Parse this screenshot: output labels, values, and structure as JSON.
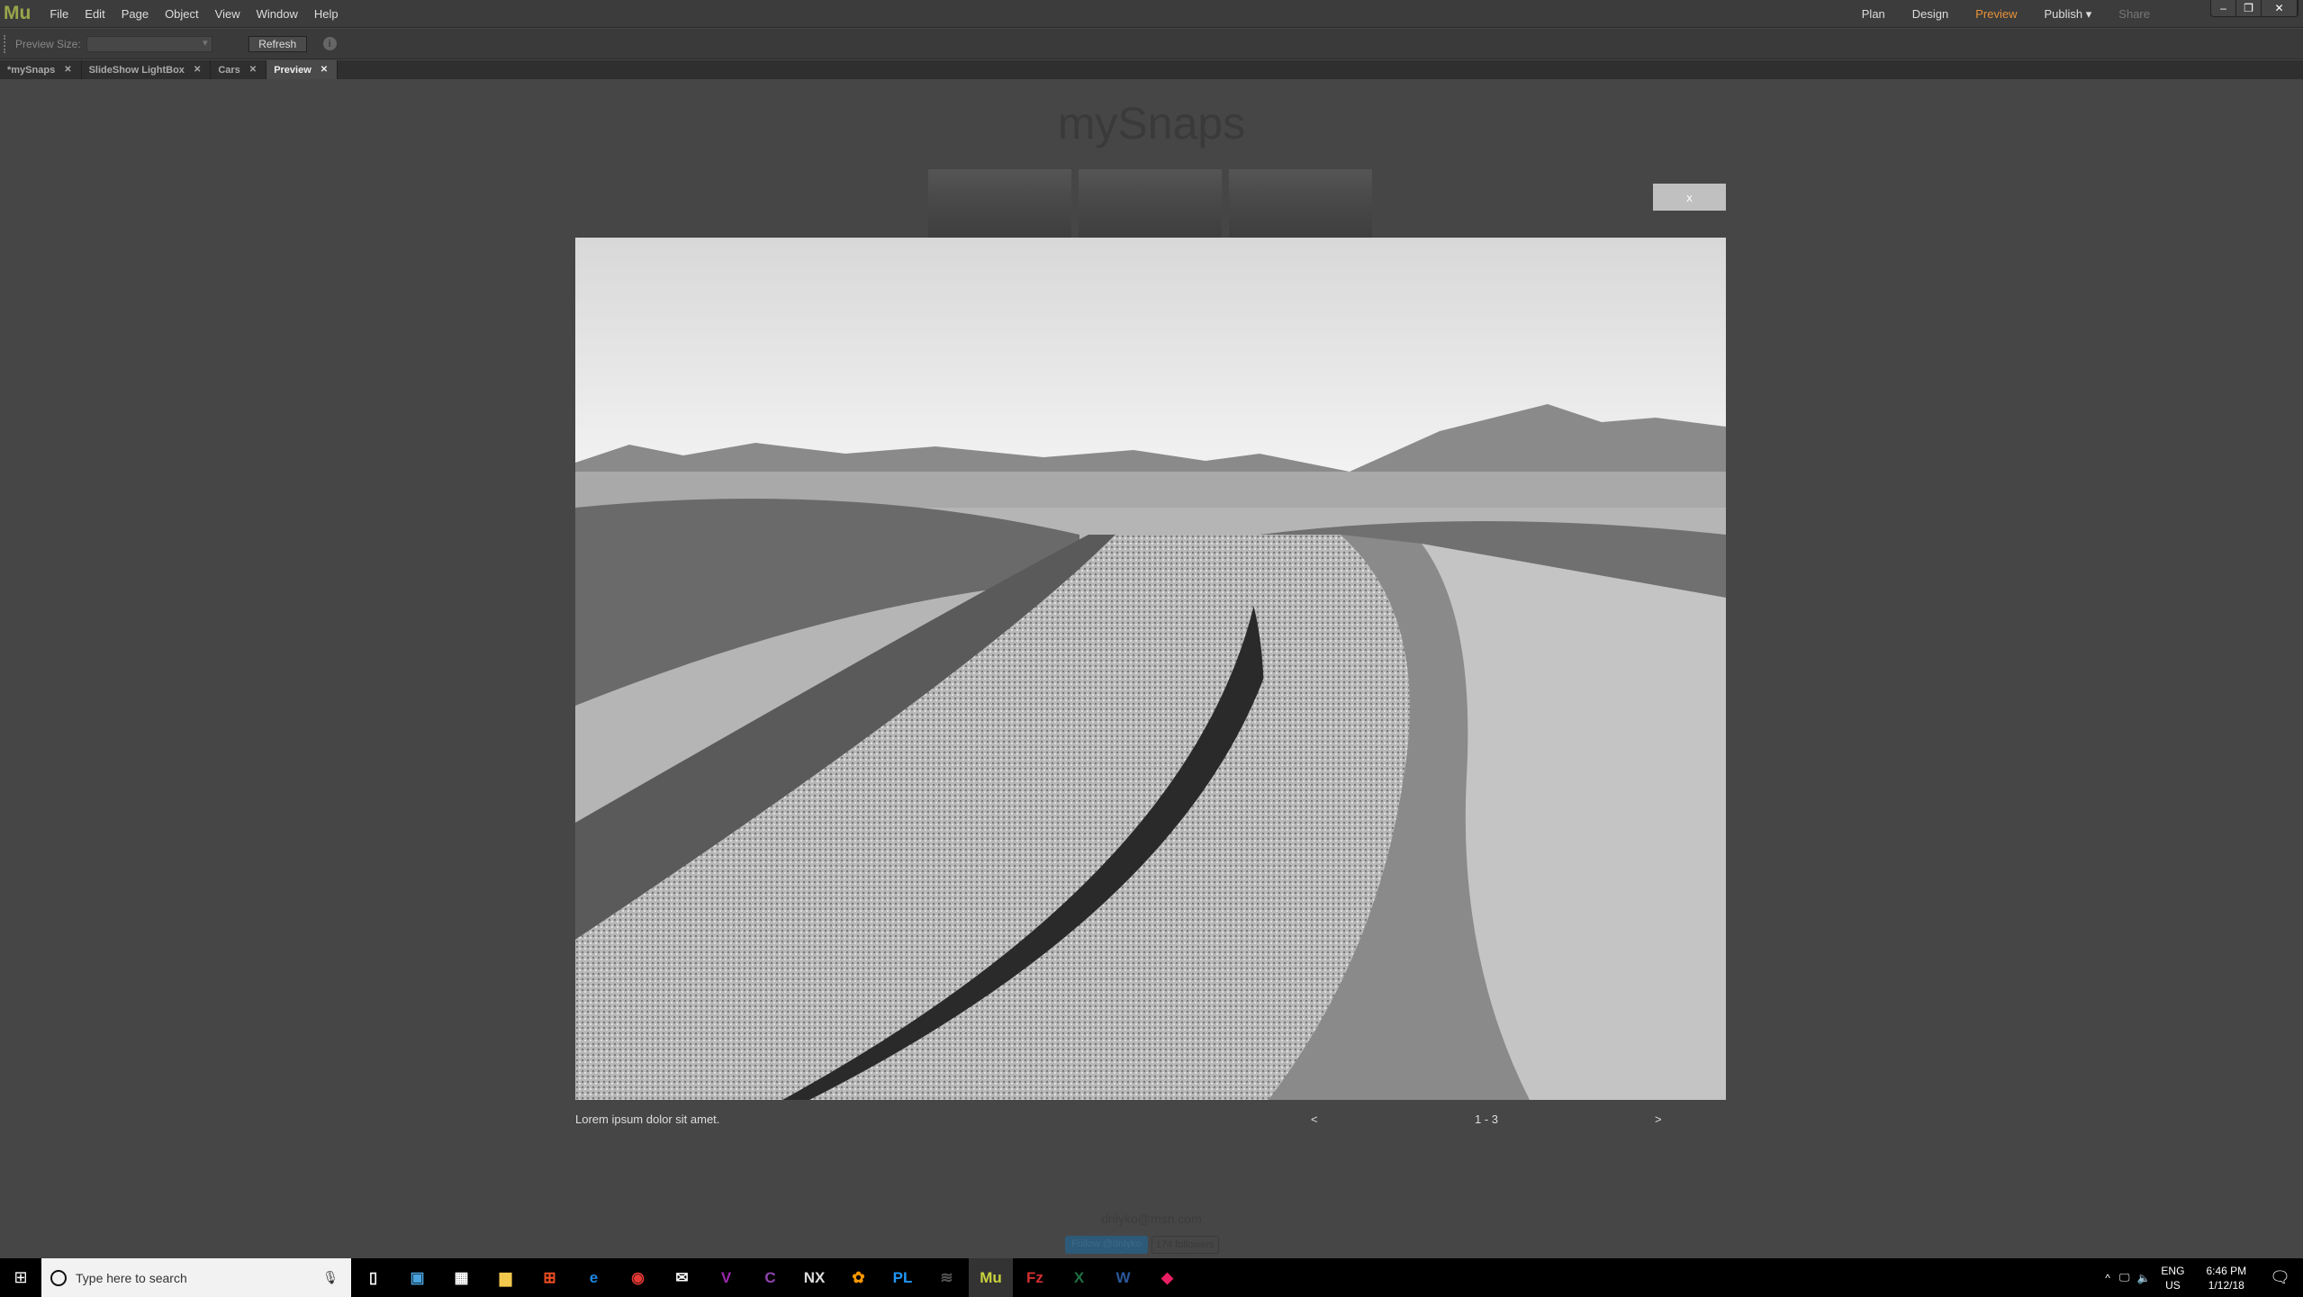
{
  "app": {
    "logo": "Mu",
    "menu": [
      "File",
      "Edit",
      "Page",
      "Object",
      "View",
      "Window",
      "Help"
    ],
    "modes": [
      {
        "label": "Plan",
        "color": "#dddddd"
      },
      {
        "label": "Design",
        "color": "#dddddd"
      },
      {
        "label": "Preview",
        "color": "#e8923a"
      },
      {
        "label": "Publish ▾",
        "color": "#dddddd"
      },
      {
        "label": "Share",
        "color": "#777777"
      }
    ],
    "window_buttons": [
      "–",
      "❐",
      "✕"
    ]
  },
  "toolbar": {
    "preview_size_label": "Preview Size:",
    "preview_size_value": "",
    "refresh_label": "Refresh",
    "info": "i"
  },
  "tabs": [
    {
      "label": "*mySnaps",
      "active": false
    },
    {
      "label": "SlideShow LightBox",
      "active": false
    },
    {
      "label": "Cars",
      "active": false
    },
    {
      "label": "Preview",
      "active": true
    }
  ],
  "page": {
    "title": "mySnaps",
    "lightbox_close": "x",
    "caption": "Lorem ipsum dolor sit amet.",
    "prev": "<",
    "counter": "1 - 3",
    "next": ">",
    "email": "dnlyko@msn.com",
    "follow_label": "Follow @dnlyko",
    "followers": "174 followers"
  },
  "taskbar": {
    "search_placeholder": "Type here to search",
    "lang1": "ENG",
    "lang2": "US",
    "time": "6:46 PM",
    "date": "1/12/18",
    "apps": [
      {
        "name": "task-view",
        "glyph": "▯",
        "color": "#fff"
      },
      {
        "name": "remote",
        "glyph": "▣",
        "color": "#4aa3df"
      },
      {
        "name": "calculator",
        "glyph": "▦",
        "color": "#fff"
      },
      {
        "name": "file-explorer",
        "glyph": "▆",
        "color": "#f2c94c"
      },
      {
        "name": "store",
        "glyph": "⊞",
        "color": "#f25022"
      },
      {
        "name": "edge",
        "glyph": "e",
        "color": "#1e88e5"
      },
      {
        "name": "chrome",
        "glyph": "◉",
        "color": "#e53935"
      },
      {
        "name": "mail",
        "glyph": "✉",
        "color": "#fff"
      },
      {
        "name": "viewnx",
        "glyph": "V",
        "color": "#9c27b0"
      },
      {
        "name": "capture",
        "glyph": "C",
        "color": "#8e44ad"
      },
      {
        "name": "nx2",
        "glyph": "NX",
        "color": "#ddd"
      },
      {
        "name": "color-app",
        "glyph": "✿",
        "color": "#ff9800"
      },
      {
        "name": "photolab",
        "glyph": "PL",
        "color": "#2196f3"
      },
      {
        "name": "waveform",
        "glyph": "≋",
        "color": "#555"
      },
      {
        "name": "muse",
        "glyph": "Mu",
        "color": "#c8d23c",
        "active": true
      },
      {
        "name": "filezilla",
        "glyph": "Fz",
        "color": "#d32f2f"
      },
      {
        "name": "excel",
        "glyph": "X",
        "color": "#1e7145"
      },
      {
        "name": "word",
        "glyph": "W",
        "color": "#2b579a"
      },
      {
        "name": "maps",
        "glyph": "◆",
        "color": "#e91e63"
      }
    ]
  }
}
